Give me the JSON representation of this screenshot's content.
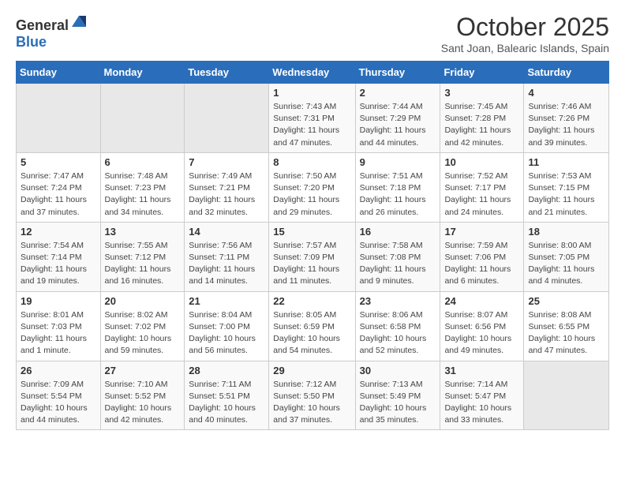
{
  "header": {
    "logo_general": "General",
    "logo_blue": "Blue",
    "month": "October 2025",
    "location": "Sant Joan, Balearic Islands, Spain"
  },
  "days_of_week": [
    "Sunday",
    "Monday",
    "Tuesday",
    "Wednesday",
    "Thursday",
    "Friday",
    "Saturday"
  ],
  "weeks": [
    [
      {
        "day": "",
        "sunrise": "",
        "sunset": "",
        "daylight": ""
      },
      {
        "day": "",
        "sunrise": "",
        "sunset": "",
        "daylight": ""
      },
      {
        "day": "",
        "sunrise": "",
        "sunset": "",
        "daylight": ""
      },
      {
        "day": "1",
        "sunrise": "Sunrise: 7:43 AM",
        "sunset": "Sunset: 7:31 PM",
        "daylight": "Daylight: 11 hours and 47 minutes."
      },
      {
        "day": "2",
        "sunrise": "Sunrise: 7:44 AM",
        "sunset": "Sunset: 7:29 PM",
        "daylight": "Daylight: 11 hours and 44 minutes."
      },
      {
        "day": "3",
        "sunrise": "Sunrise: 7:45 AM",
        "sunset": "Sunset: 7:28 PM",
        "daylight": "Daylight: 11 hours and 42 minutes."
      },
      {
        "day": "4",
        "sunrise": "Sunrise: 7:46 AM",
        "sunset": "Sunset: 7:26 PM",
        "daylight": "Daylight: 11 hours and 39 minutes."
      }
    ],
    [
      {
        "day": "5",
        "sunrise": "Sunrise: 7:47 AM",
        "sunset": "Sunset: 7:24 PM",
        "daylight": "Daylight: 11 hours and 37 minutes."
      },
      {
        "day": "6",
        "sunrise": "Sunrise: 7:48 AM",
        "sunset": "Sunset: 7:23 PM",
        "daylight": "Daylight: 11 hours and 34 minutes."
      },
      {
        "day": "7",
        "sunrise": "Sunrise: 7:49 AM",
        "sunset": "Sunset: 7:21 PM",
        "daylight": "Daylight: 11 hours and 32 minutes."
      },
      {
        "day": "8",
        "sunrise": "Sunrise: 7:50 AM",
        "sunset": "Sunset: 7:20 PM",
        "daylight": "Daylight: 11 hours and 29 minutes."
      },
      {
        "day": "9",
        "sunrise": "Sunrise: 7:51 AM",
        "sunset": "Sunset: 7:18 PM",
        "daylight": "Daylight: 11 hours and 26 minutes."
      },
      {
        "day": "10",
        "sunrise": "Sunrise: 7:52 AM",
        "sunset": "Sunset: 7:17 PM",
        "daylight": "Daylight: 11 hours and 24 minutes."
      },
      {
        "day": "11",
        "sunrise": "Sunrise: 7:53 AM",
        "sunset": "Sunset: 7:15 PM",
        "daylight": "Daylight: 11 hours and 21 minutes."
      }
    ],
    [
      {
        "day": "12",
        "sunrise": "Sunrise: 7:54 AM",
        "sunset": "Sunset: 7:14 PM",
        "daylight": "Daylight: 11 hours and 19 minutes."
      },
      {
        "day": "13",
        "sunrise": "Sunrise: 7:55 AM",
        "sunset": "Sunset: 7:12 PM",
        "daylight": "Daylight: 11 hours and 16 minutes."
      },
      {
        "day": "14",
        "sunrise": "Sunrise: 7:56 AM",
        "sunset": "Sunset: 7:11 PM",
        "daylight": "Daylight: 11 hours and 14 minutes."
      },
      {
        "day": "15",
        "sunrise": "Sunrise: 7:57 AM",
        "sunset": "Sunset: 7:09 PM",
        "daylight": "Daylight: 11 hours and 11 minutes."
      },
      {
        "day": "16",
        "sunrise": "Sunrise: 7:58 AM",
        "sunset": "Sunset: 7:08 PM",
        "daylight": "Daylight: 11 hours and 9 minutes."
      },
      {
        "day": "17",
        "sunrise": "Sunrise: 7:59 AM",
        "sunset": "Sunset: 7:06 PM",
        "daylight": "Daylight: 11 hours and 6 minutes."
      },
      {
        "day": "18",
        "sunrise": "Sunrise: 8:00 AM",
        "sunset": "Sunset: 7:05 PM",
        "daylight": "Daylight: 11 hours and 4 minutes."
      }
    ],
    [
      {
        "day": "19",
        "sunrise": "Sunrise: 8:01 AM",
        "sunset": "Sunset: 7:03 PM",
        "daylight": "Daylight: 11 hours and 1 minute."
      },
      {
        "day": "20",
        "sunrise": "Sunrise: 8:02 AM",
        "sunset": "Sunset: 7:02 PM",
        "daylight": "Daylight: 10 hours and 59 minutes."
      },
      {
        "day": "21",
        "sunrise": "Sunrise: 8:04 AM",
        "sunset": "Sunset: 7:00 PM",
        "daylight": "Daylight: 10 hours and 56 minutes."
      },
      {
        "day": "22",
        "sunrise": "Sunrise: 8:05 AM",
        "sunset": "Sunset: 6:59 PM",
        "daylight": "Daylight: 10 hours and 54 minutes."
      },
      {
        "day": "23",
        "sunrise": "Sunrise: 8:06 AM",
        "sunset": "Sunset: 6:58 PM",
        "daylight": "Daylight: 10 hours and 52 minutes."
      },
      {
        "day": "24",
        "sunrise": "Sunrise: 8:07 AM",
        "sunset": "Sunset: 6:56 PM",
        "daylight": "Daylight: 10 hours and 49 minutes."
      },
      {
        "day": "25",
        "sunrise": "Sunrise: 8:08 AM",
        "sunset": "Sunset: 6:55 PM",
        "daylight": "Daylight: 10 hours and 47 minutes."
      }
    ],
    [
      {
        "day": "26",
        "sunrise": "Sunrise: 7:09 AM",
        "sunset": "Sunset: 5:54 PM",
        "daylight": "Daylight: 10 hours and 44 minutes."
      },
      {
        "day": "27",
        "sunrise": "Sunrise: 7:10 AM",
        "sunset": "Sunset: 5:52 PM",
        "daylight": "Daylight: 10 hours and 42 minutes."
      },
      {
        "day": "28",
        "sunrise": "Sunrise: 7:11 AM",
        "sunset": "Sunset: 5:51 PM",
        "daylight": "Daylight: 10 hours and 40 minutes."
      },
      {
        "day": "29",
        "sunrise": "Sunrise: 7:12 AM",
        "sunset": "Sunset: 5:50 PM",
        "daylight": "Daylight: 10 hours and 37 minutes."
      },
      {
        "day": "30",
        "sunrise": "Sunrise: 7:13 AM",
        "sunset": "Sunset: 5:49 PM",
        "daylight": "Daylight: 10 hours and 35 minutes."
      },
      {
        "day": "31",
        "sunrise": "Sunrise: 7:14 AM",
        "sunset": "Sunset: 5:47 PM",
        "daylight": "Daylight: 10 hours and 33 minutes."
      },
      {
        "day": "",
        "sunrise": "",
        "sunset": "",
        "daylight": ""
      }
    ]
  ]
}
